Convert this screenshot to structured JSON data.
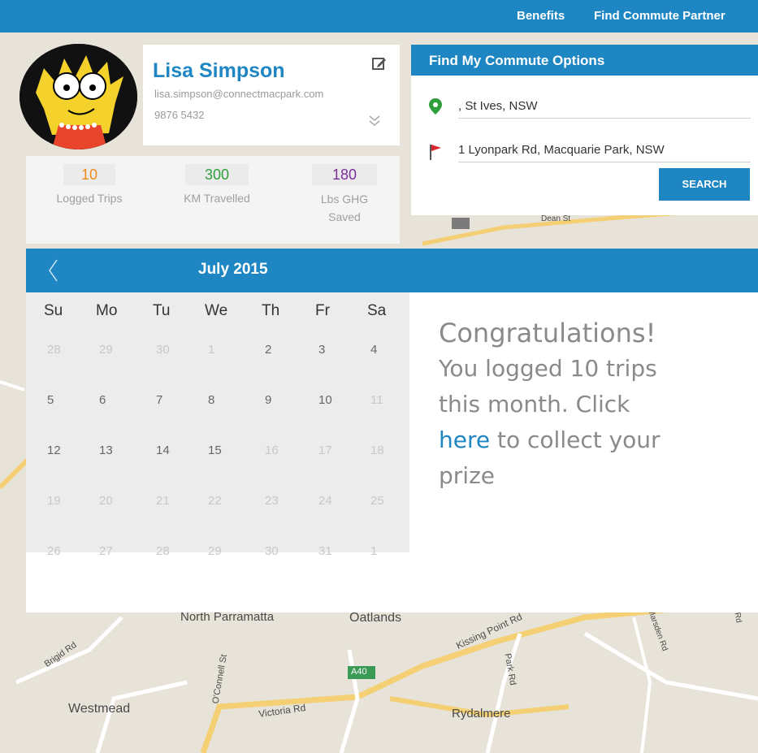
{
  "nav": {
    "items": [
      "Benefits",
      "Find Commute Partner"
    ]
  },
  "profile": {
    "name": "Lisa Simpson",
    "email": "lisa.simpson@connectmacpark.com",
    "phone": "9876 5432",
    "edit_icon": "edit-icon",
    "expand_icon": "chevron-down-icon"
  },
  "stats": [
    {
      "value": "10",
      "label": "Logged Trips",
      "color": "#f08a1c"
    },
    {
      "value": "300",
      "label": "KM Travelled",
      "color": "#2e9e3a"
    },
    {
      "value": "180",
      "label": "Lbs GHG Saved",
      "color": "#7a2f9a"
    }
  ],
  "commute": {
    "title": "Find My Commute Options",
    "origin": ", St Ives, NSW",
    "destination": "1 Lyonpark Rd, Macquarie Park, NSW",
    "origin_icon": "map-pin-icon",
    "destination_icon": "flag-icon",
    "search_label": "SEARCH"
  },
  "calendar": {
    "prev_icon": "chevron-left-icon",
    "title": "July 2015",
    "weekdays": [
      "Su",
      "Mo",
      "Tu",
      "We",
      "Th",
      "Fr",
      "Sa"
    ],
    "weeks": [
      [
        {
          "d": "28",
          "m": true
        },
        {
          "d": "29",
          "m": true
        },
        {
          "d": "30",
          "m": true
        },
        {
          "d": "1",
          "m": true
        },
        {
          "d": "2",
          "m": false
        },
        {
          "d": "3",
          "m": false
        },
        {
          "d": "4",
          "m": false
        }
      ],
      [
        {
          "d": "5",
          "m": false
        },
        {
          "d": "6",
          "m": false
        },
        {
          "d": "7",
          "m": false
        },
        {
          "d": "8",
          "m": false
        },
        {
          "d": "9",
          "m": false
        },
        {
          "d": "10",
          "m": false
        },
        {
          "d": "11",
          "m": true
        }
      ],
      [
        {
          "d": "12",
          "m": false
        },
        {
          "d": "13",
          "m": false
        },
        {
          "d": "14",
          "m": false
        },
        {
          "d": "15",
          "m": false
        },
        {
          "d": "16",
          "m": true
        },
        {
          "d": "17",
          "m": true
        },
        {
          "d": "18",
          "m": true
        }
      ],
      [
        {
          "d": "19",
          "m": true
        },
        {
          "d": "20",
          "m": true
        },
        {
          "d": "21",
          "m": true
        },
        {
          "d": "22",
          "m": true
        },
        {
          "d": "23",
          "m": true
        },
        {
          "d": "24",
          "m": true
        },
        {
          "d": "25",
          "m": true
        }
      ],
      [
        {
          "d": "26",
          "m": true
        },
        {
          "d": "27",
          "m": true
        },
        {
          "d": "28",
          "m": true
        },
        {
          "d": "29",
          "m": true
        },
        {
          "d": "30",
          "m": true
        },
        {
          "d": "31",
          "m": true
        },
        {
          "d": "1",
          "m": true
        }
      ]
    ]
  },
  "message": {
    "line1": "Congratulations!",
    "line2": "You logged 10 trips",
    "line3": "this month. Click",
    "link": "here",
    "line4_rest": " to collect your",
    "line5": "prize"
  },
  "map_labels": [
    "North Parramatta",
    "Oatlands",
    "Westmead",
    "Rydalmere",
    "Victoria Rd",
    "Kissing Point Rd",
    "Dean St",
    "A40",
    "Brigid Rd",
    "O'Connell St",
    "Park Rd",
    "Shaftsbury Rd",
    "Marsden Rd"
  ]
}
